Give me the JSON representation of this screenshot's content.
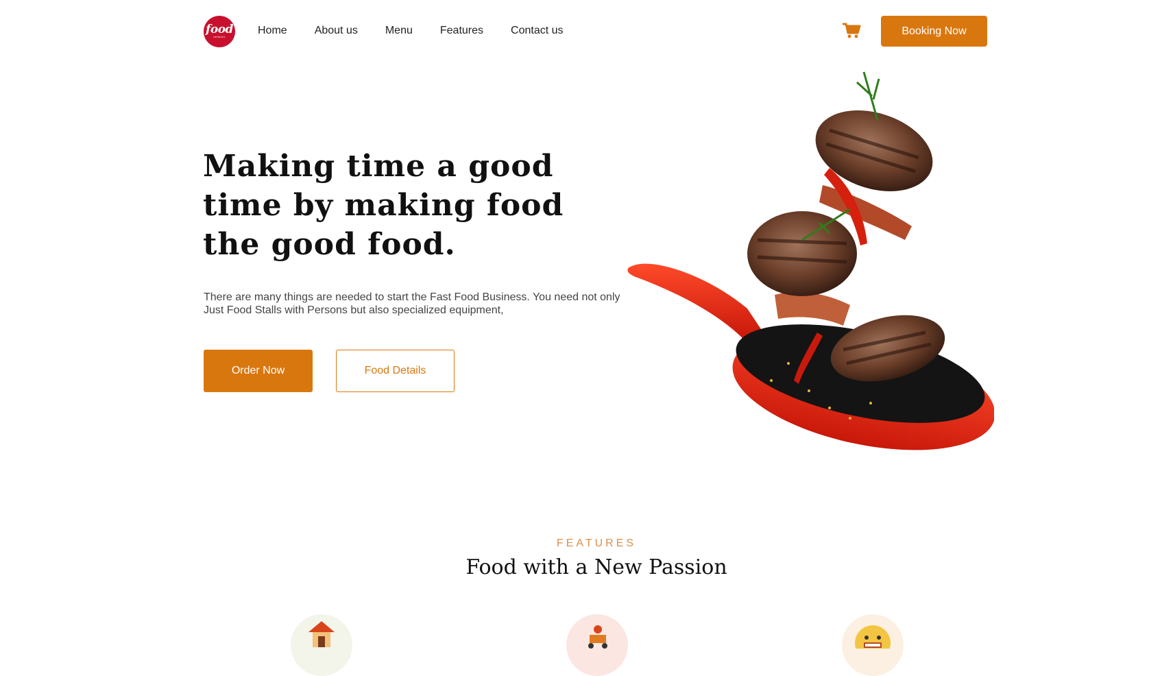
{
  "brand": {
    "logo_text": "food",
    "logo_sub": "network",
    "color": "#c8102e"
  },
  "nav": {
    "items": [
      "Home",
      "About us",
      "Menu",
      "Features",
      "Contact us"
    ],
    "cart_icon": "shopping-cart-icon",
    "booking_label": "Booking Now"
  },
  "hero": {
    "title": "Making time a good time by making food the good food.",
    "description": "There are many things are needed to start the Fast Food Business. You need not only Just Food Stalls with Persons but also specialized equipment,",
    "order_label": "Order Now",
    "details_label": "Food Details",
    "image": "flying-burger-patties-frying-pan"
  },
  "features": {
    "eyebrow": "FEATURES",
    "title": "Food with a New Passion",
    "icons": [
      "house-icon",
      "delivery-scooter-icon",
      "smiley-face-icon"
    ]
  },
  "colors": {
    "accent": "#d9770f",
    "eyebrow": "#d9904a",
    "text": "#222222"
  }
}
